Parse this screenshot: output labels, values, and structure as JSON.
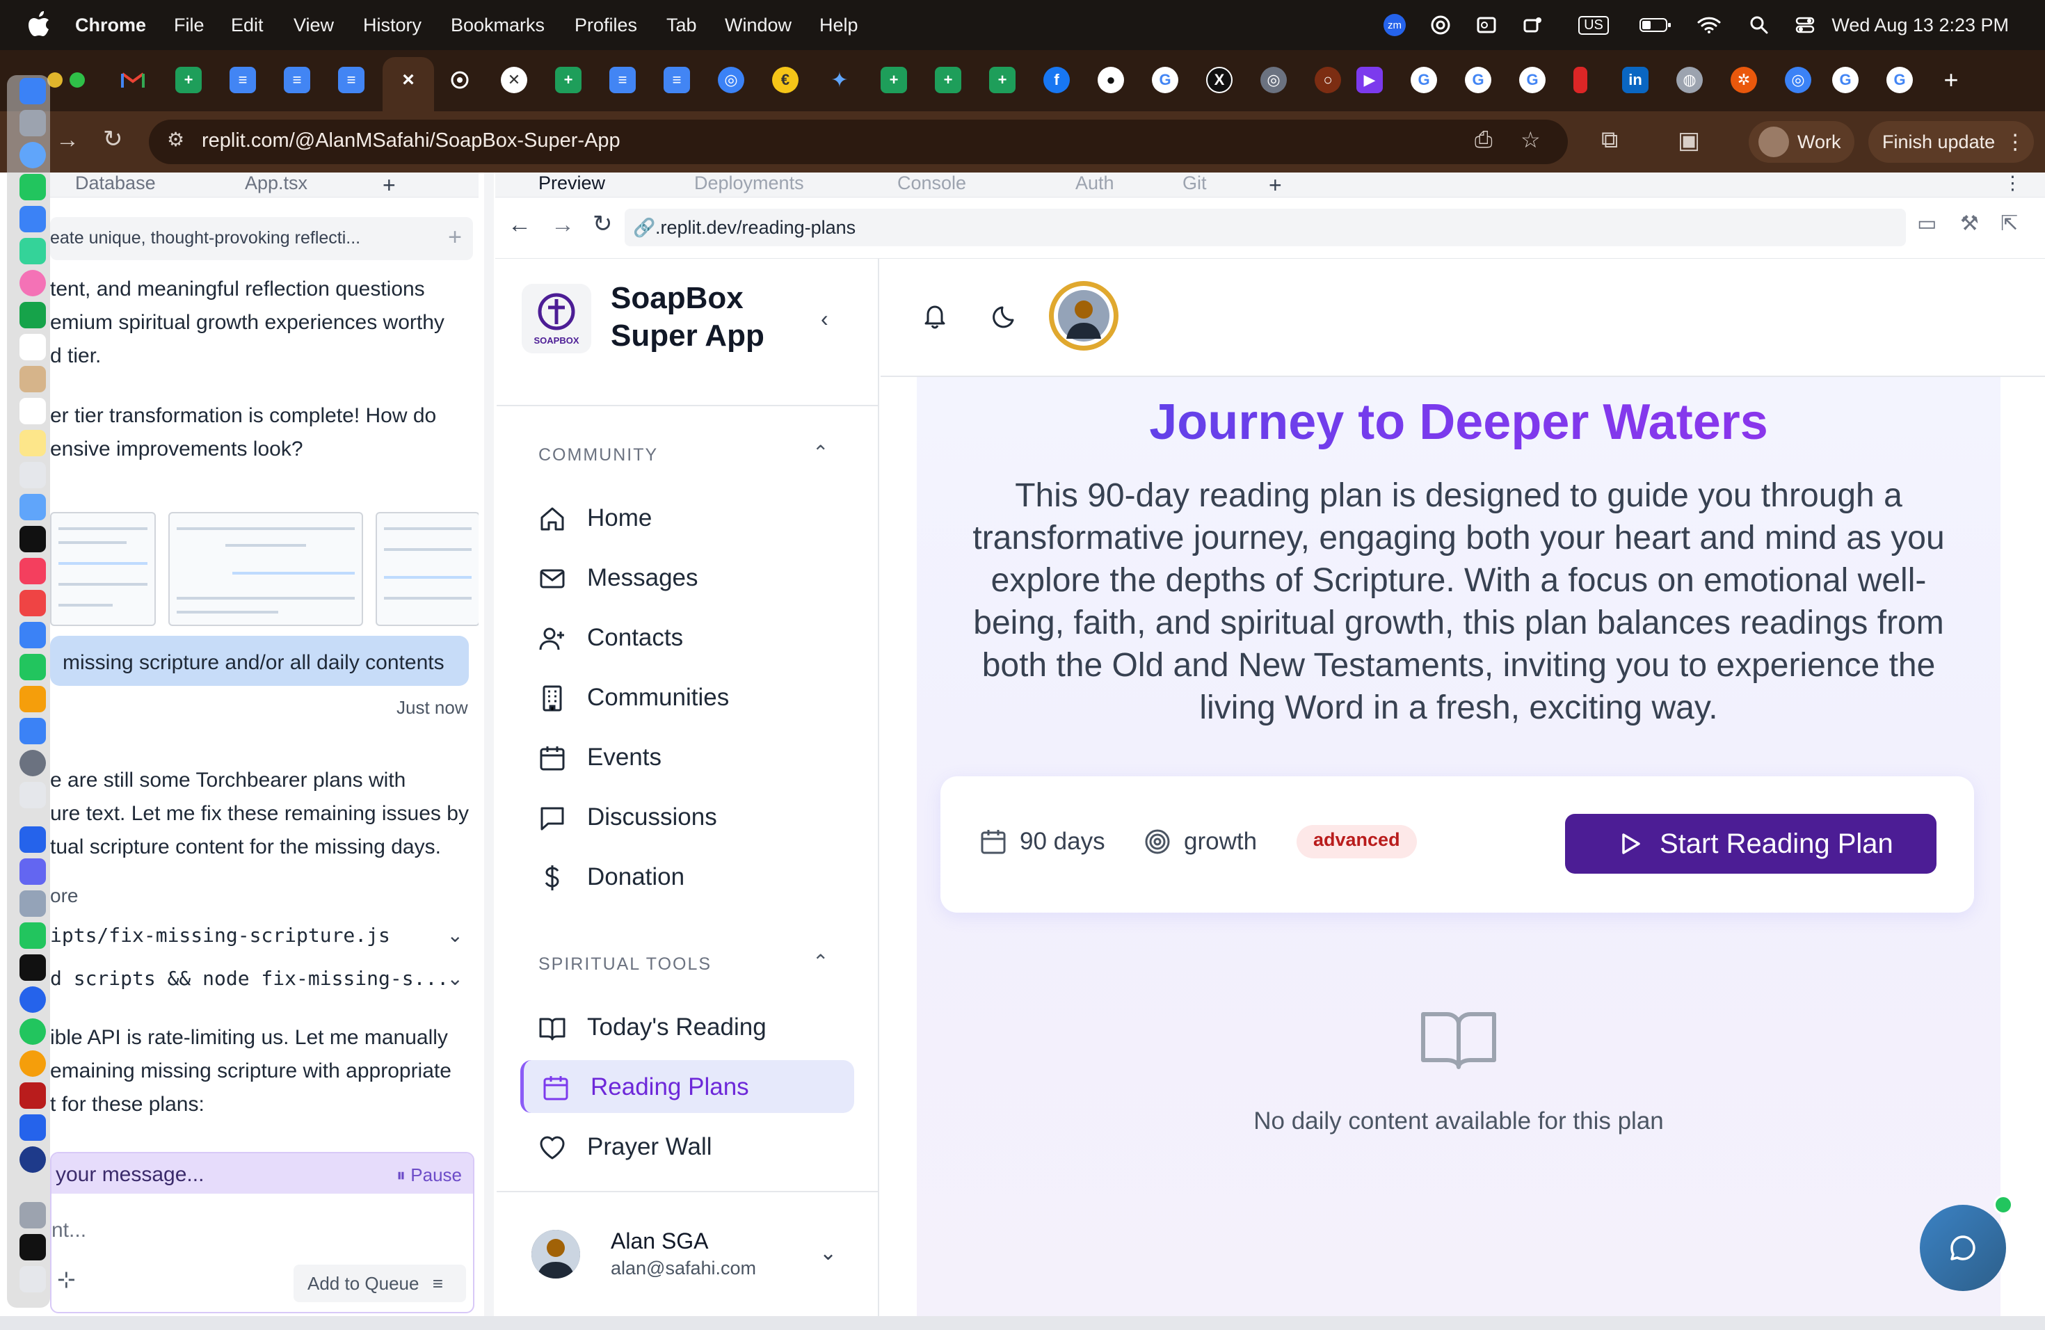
{
  "menubar": {
    "app_name": "Chrome",
    "items": [
      "File",
      "Edit",
      "View",
      "History",
      "Bookmarks",
      "Profiles",
      "Tab",
      "Window",
      "Help"
    ],
    "clock": "Wed Aug 13  2:23 PM",
    "keyboard_layout": "US",
    "zoom_label": "zm"
  },
  "browser": {
    "url": "replit.com/@AlanMSafahi/SoapBox-Super-App",
    "profile_label": "Work",
    "update_label": "Finish update"
  },
  "replit": {
    "top_tabs": [
      "Database",
      "App.tsx"
    ],
    "tool_tabs": [
      "Preview",
      "Deployments",
      "Console",
      "Auth",
      "Git"
    ],
    "preview_url": ".replit.dev/reading-plans"
  },
  "chat": {
    "task_title": "eate unique, thought-provoking reflecti...",
    "lines_1": [
      "tent, and meaningful reflection questions",
      "emium spiritual growth experiences worthy",
      "d tier."
    ],
    "lines_2": [
      "er tier transformation is complete! How do",
      "ensive improvements look?"
    ],
    "user_message": "missing scripture and/or all daily contents",
    "timestamp": "Just now",
    "lines_3": [
      "e are still some Torchbearer plans with",
      "ure text. Let me fix these remaining issues by",
      "tual scripture content for the missing days."
    ],
    "more_label": "ore",
    "code_rows": [
      "ipts/fix-missing-scripture.js",
      "d scripts && node fix-missing-s..."
    ],
    "lines_4": [
      "ible API is rate-limiting us. Let me manually",
      "emaining missing scripture with appropriate",
      "t for these plans:"
    ],
    "input_placeholder": "your message...",
    "pause_label": "Pause",
    "input_text": "nt...",
    "queue_label": "Add to Queue"
  },
  "app": {
    "title": "SoapBox Super App",
    "logo_text": "SOAPBOX",
    "sections": [
      {
        "label": "COMMUNITY",
        "items": [
          "Home",
          "Messages",
          "Contacts",
          "Communities",
          "Events",
          "Discussions",
          "Donation"
        ]
      },
      {
        "label": "SPIRITUAL TOOLS",
        "items": [
          "Today's Reading",
          "Reading Plans",
          "Prayer Wall"
        ]
      }
    ],
    "active_item": "Reading Plans",
    "user": {
      "name": "Alan SGA",
      "email": "alan@safahi.com"
    }
  },
  "plan": {
    "title": "Journey to Deeper Waters",
    "description": "This 90-day reading plan is designed to guide you through a transformative journey, engaging both your heart and mind as you explore the depths of Scripture. With a focus on emotional well-being, faith, and spiritual growth, this plan balances readings from both the Old and New Testaments, inviting you to experience the living Word in a fresh, exciting way.",
    "duration": "90 days",
    "category": "growth",
    "level": "advanced",
    "start_label": "Start Reading Plan",
    "empty_message": "No daily content available for this plan"
  },
  "colors": {
    "accent": "#7c3aed",
    "button": "#4c1d95",
    "badge_bg": "#fde8e8",
    "badge_text": "#b91c1c",
    "browser_chrome": "#4a2e1d"
  }
}
